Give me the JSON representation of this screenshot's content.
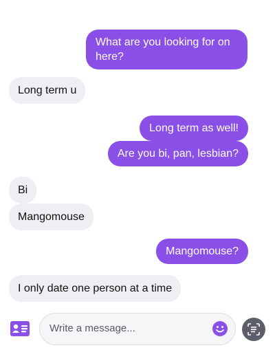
{
  "messages": [
    {
      "from": "me",
      "text": "What are you looking for on here?"
    },
    {
      "from": "them",
      "text": "Long term u"
    },
    {
      "from": "me",
      "text": "Long term as well!"
    },
    {
      "from": "me",
      "text": "Are you bi, pan, lesbian?"
    },
    {
      "from": "them",
      "text": "Bi"
    },
    {
      "from": "them",
      "text": "Mangomouse"
    },
    {
      "from": "me",
      "text": "Mangomouse?"
    },
    {
      "from": "them",
      "text": "I only date one person at a time"
    }
  ],
  "composer": {
    "placeholder": "Write a message...",
    "left_icon": "contact-card-icon",
    "emoji_icon": "smiley-icon",
    "right_icon": "scan-text-icon"
  },
  "colors": {
    "outgoing_bubble": "#8a4fe6",
    "incoming_bubble": "#efeff3",
    "accent": "#8a4fe6"
  }
}
